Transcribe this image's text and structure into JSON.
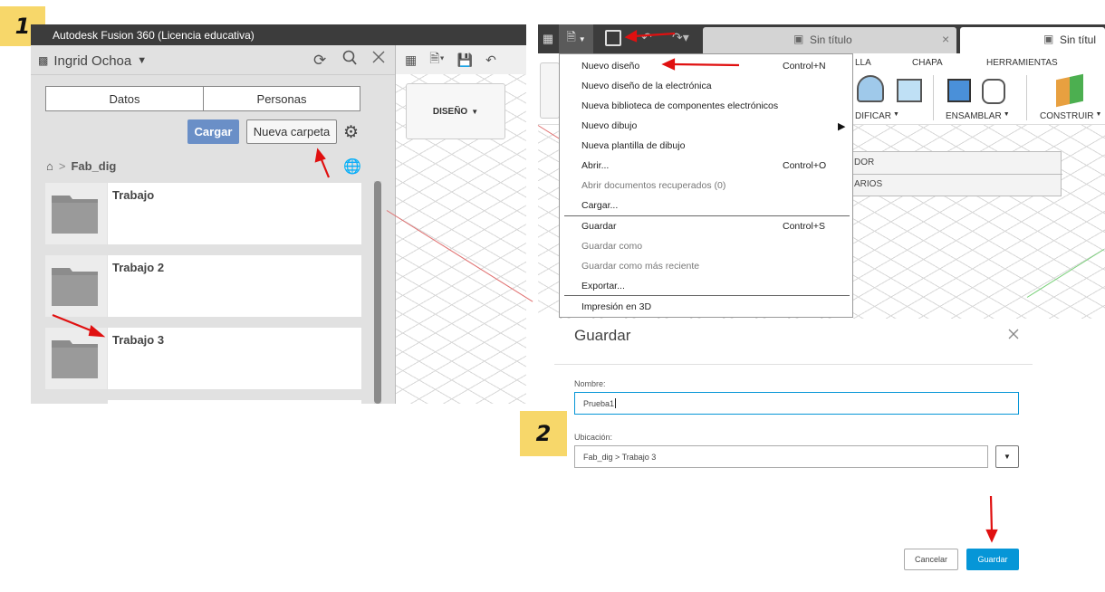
{
  "steps": {
    "one": "1",
    "two": "2"
  },
  "left": {
    "window_title": "Autodesk Fusion 360 (Licencia educativa)",
    "user_name": "Ingrid Ochoa",
    "tabs": [
      "Datos",
      "Personas"
    ],
    "upload_label": "Cargar",
    "new_folder_label": "Nueva carpeta",
    "breadcrumb": "Fab_dig",
    "folders": [
      "Trabajo",
      "Trabajo 2",
      "Trabajo 3"
    ],
    "workspace_label": "DISEÑO"
  },
  "right": {
    "doc_tab_1": "Sin título",
    "doc_tab_2": "Sin títul",
    "ribbon_tabs": [
      "LLA",
      "CHAPA",
      "HERRAMIENTAS"
    ],
    "ribbon_groups": [
      "DIFICAR",
      "ENSAMBLAR",
      "CONSTRUIR"
    ],
    "browser_rows": [
      "DOR",
      "ARIOS"
    ],
    "file_menu": [
      {
        "label": "Nuevo diseño",
        "shortcut": "Control+N"
      },
      {
        "label": "Nuevo diseño de la electrónica"
      },
      {
        "label": "Nueva biblioteca de componentes electrónicos"
      },
      {
        "label": "Nuevo dibujo"
      },
      {
        "label": "Nueva plantilla de dibujo"
      },
      {
        "label": "Abrir...",
        "shortcut": "Control+O"
      },
      {
        "label": "Abrir documentos recuperados (0)"
      },
      {
        "label": "Cargar..."
      },
      {
        "label": "Guardar",
        "shortcut": "Control+S"
      },
      {
        "label": "Guardar como"
      },
      {
        "label": "Guardar como más reciente"
      },
      {
        "label": "Exportar..."
      },
      {
        "label": "Impresión en 3D"
      }
    ]
  },
  "dialog": {
    "title": "Guardar",
    "name_label": "Nombre:",
    "name_value": "Prueba1",
    "location_label": "Ubicación:",
    "location_value": "Fab_dig > Trabajo 3",
    "cancel_label": "Cancelar",
    "save_label": "Guardar"
  },
  "colors": {
    "accent": "#0696d7",
    "upload": "#6a8fc7",
    "step": "#f7d76a",
    "arrow": "#e01010"
  }
}
